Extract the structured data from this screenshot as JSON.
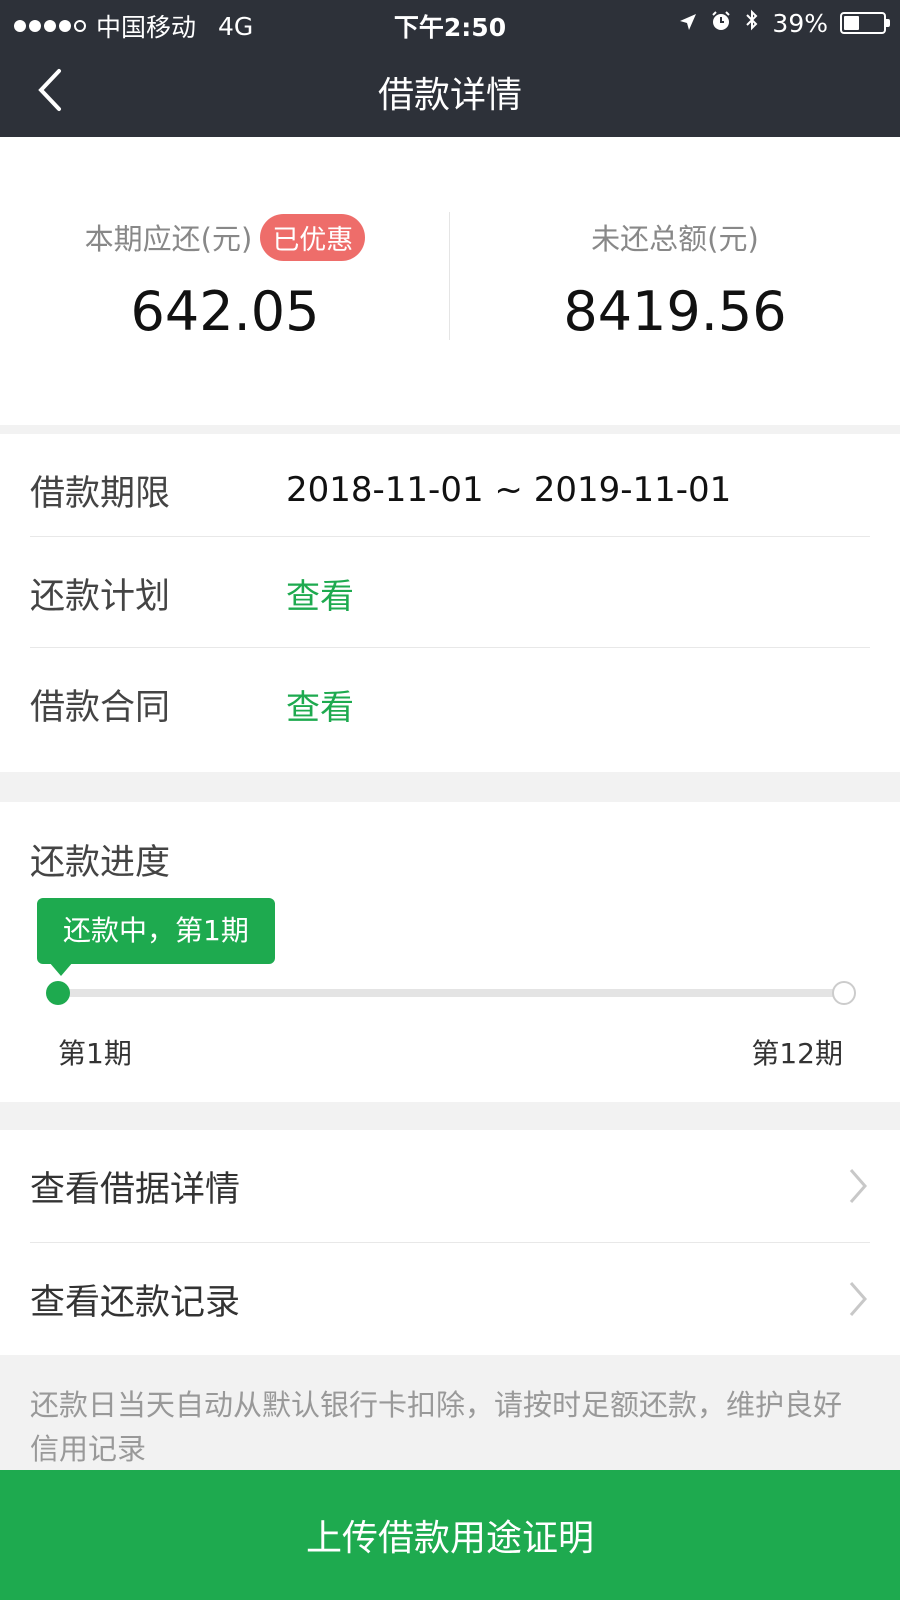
{
  "status_bar": {
    "carrier": "中国移动",
    "network": "4G",
    "time": "下午2:50",
    "battery": "39%",
    "battery_level": 0.39,
    "icons": [
      "location-arrow-icon",
      "alarm-icon",
      "bluetooth-icon",
      "battery-icon"
    ]
  },
  "nav": {
    "title": "借款详情",
    "back_icon": "chevron-left-icon"
  },
  "summary": {
    "current_label": "本期应还(元)",
    "current_badge": "已优惠",
    "current_value": "642.05",
    "total_label": "未还总额(元)",
    "total_value": "8419.56"
  },
  "info": {
    "rows": [
      {
        "label": "借款期限",
        "value": "2018-11-01 ~ 2019-11-01"
      },
      {
        "label": "还款计划",
        "value": "查看"
      },
      {
        "label": "借款合同",
        "value": "查看"
      }
    ]
  },
  "progress": {
    "title": "还款进度",
    "tooltip": "还款中，第1期",
    "start_label": "第1期",
    "end_label": "第12期",
    "current_period": 1,
    "total_periods": 12
  },
  "links": [
    {
      "label": "查看借据详情",
      "icon": "chevron-right-icon"
    },
    {
      "label": "查看还款记录",
      "icon": "chevron-right-icon"
    }
  ],
  "notice": "还款日当天自动从默认银行卡扣除，请按时足额还款，维护良好信用记录",
  "cta": {
    "label": "上传借款用途证明"
  },
  "colors": {
    "nav_bg": "#2d3139",
    "accent_green": "#1eaa4f",
    "badge_red": "#ee6d6a"
  }
}
